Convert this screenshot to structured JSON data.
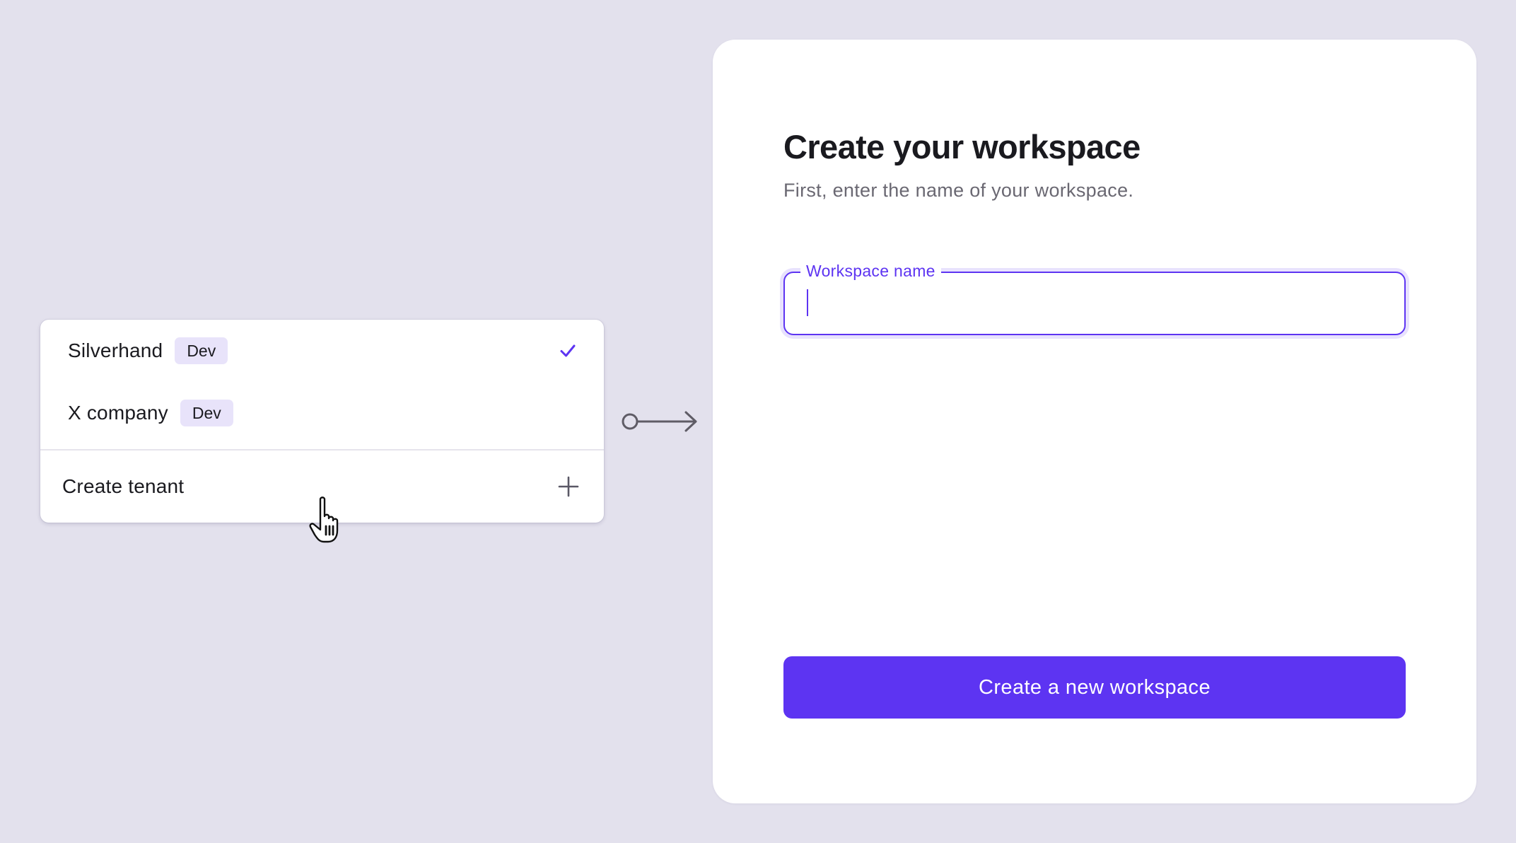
{
  "tenant_switcher": {
    "tenants": [
      {
        "name": "Silverhand",
        "tag": "Dev",
        "selected": true
      },
      {
        "name": "X company",
        "tag": "Dev",
        "selected": false
      }
    ],
    "create_label": "Create tenant",
    "icons": {
      "selected": "check-icon",
      "create": "plus-icon",
      "cursor": "hand-pointer-icon",
      "connector": "arrow-right-icon"
    }
  },
  "workspace_form": {
    "title": "Create your workspace",
    "subtitle": "First, enter the name of your workspace.",
    "name_field": {
      "label": "Workspace name",
      "value": ""
    },
    "submit_label": "Create a new workspace"
  },
  "colors": {
    "background": "#e3e1ed",
    "accent": "#5d34f2",
    "tag_background": "#e8e3fa",
    "text_primary": "#1a1a1f",
    "text_secondary": "#6a6872"
  }
}
